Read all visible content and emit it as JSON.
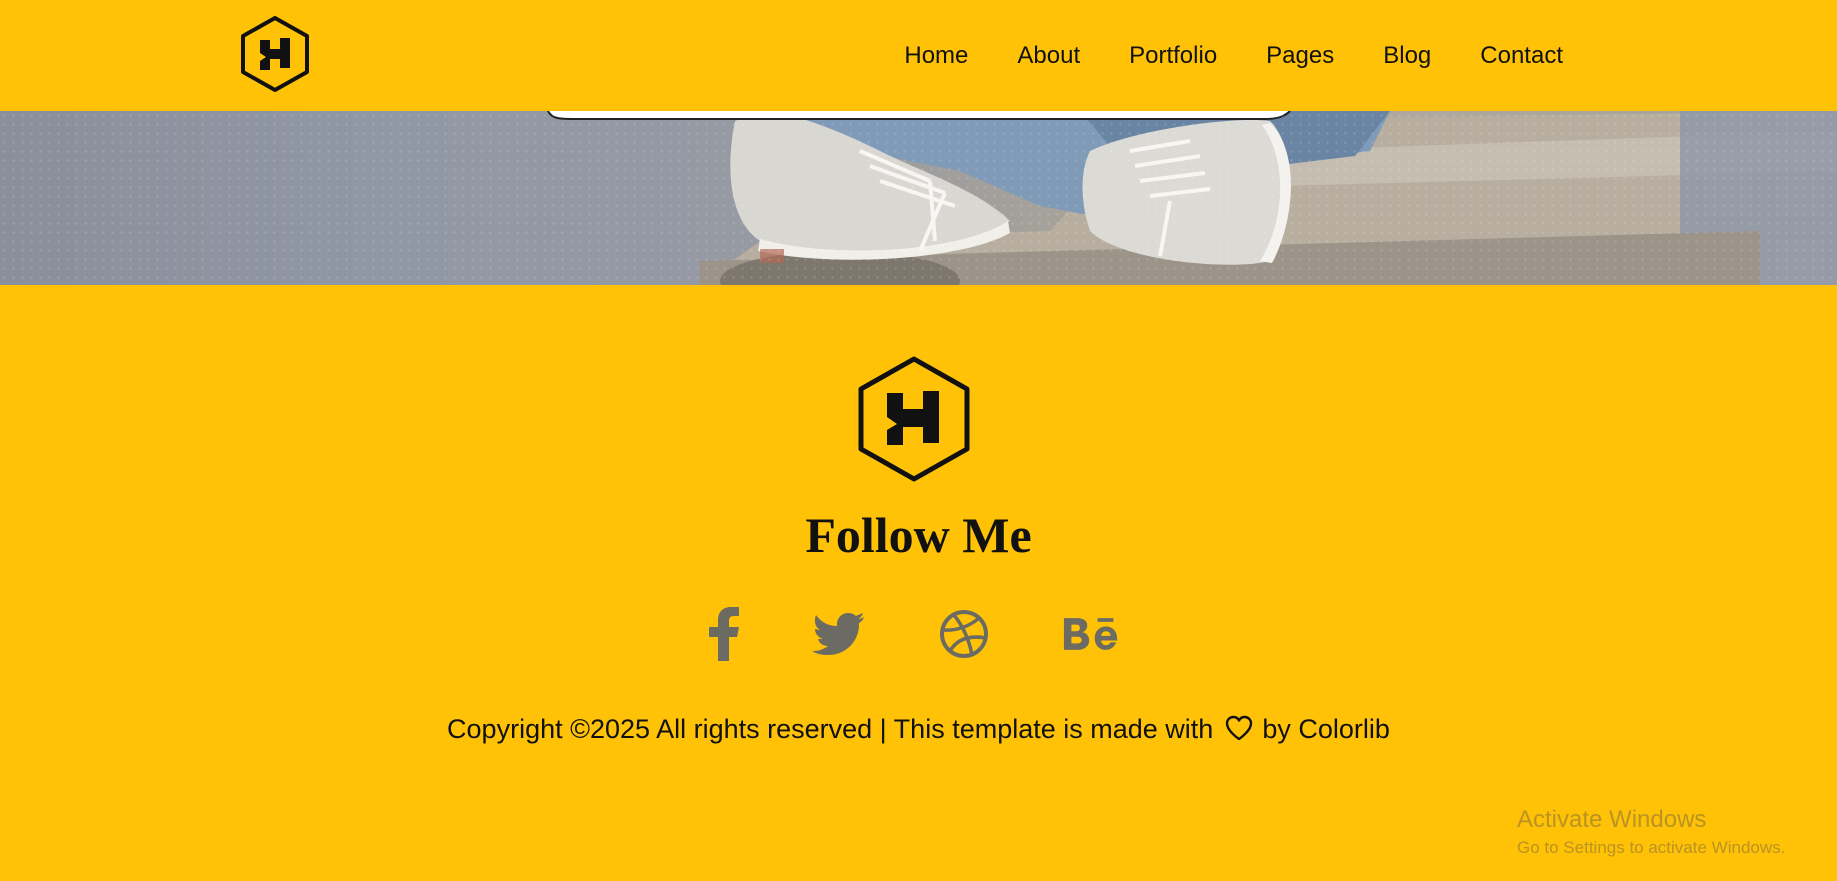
{
  "nav": {
    "logo_icon": "hexagon-h-logo-icon",
    "items": [
      {
        "label": "Home"
      },
      {
        "label": "About"
      },
      {
        "label": "Portfolio"
      },
      {
        "label": "Pages"
      },
      {
        "label": "Blog"
      },
      {
        "label": "Contact"
      }
    ]
  },
  "hero": {
    "image": "photo-sneakers-on-stone-ledge"
  },
  "footer": {
    "logo_icon": "hexagon-h-logo-icon",
    "follow_title": "Follow Me",
    "social_icons": [
      "facebook-icon",
      "twitter-icon",
      "dribbble-icon",
      "behance-icon"
    ],
    "copyright_prefix": "Copyright ©2025 All rights reserved | This template is made with",
    "copyright_by": "by",
    "copyright_link": "Colorlib",
    "heart_icon": "heart-outline-icon"
  },
  "watermark": {
    "title": "Activate Windows",
    "subtitle": "Go to Settings to activate Windows."
  },
  "colors": {
    "background": "#ffc206",
    "text": "#111111",
    "social_icon": "#6b6b63"
  }
}
